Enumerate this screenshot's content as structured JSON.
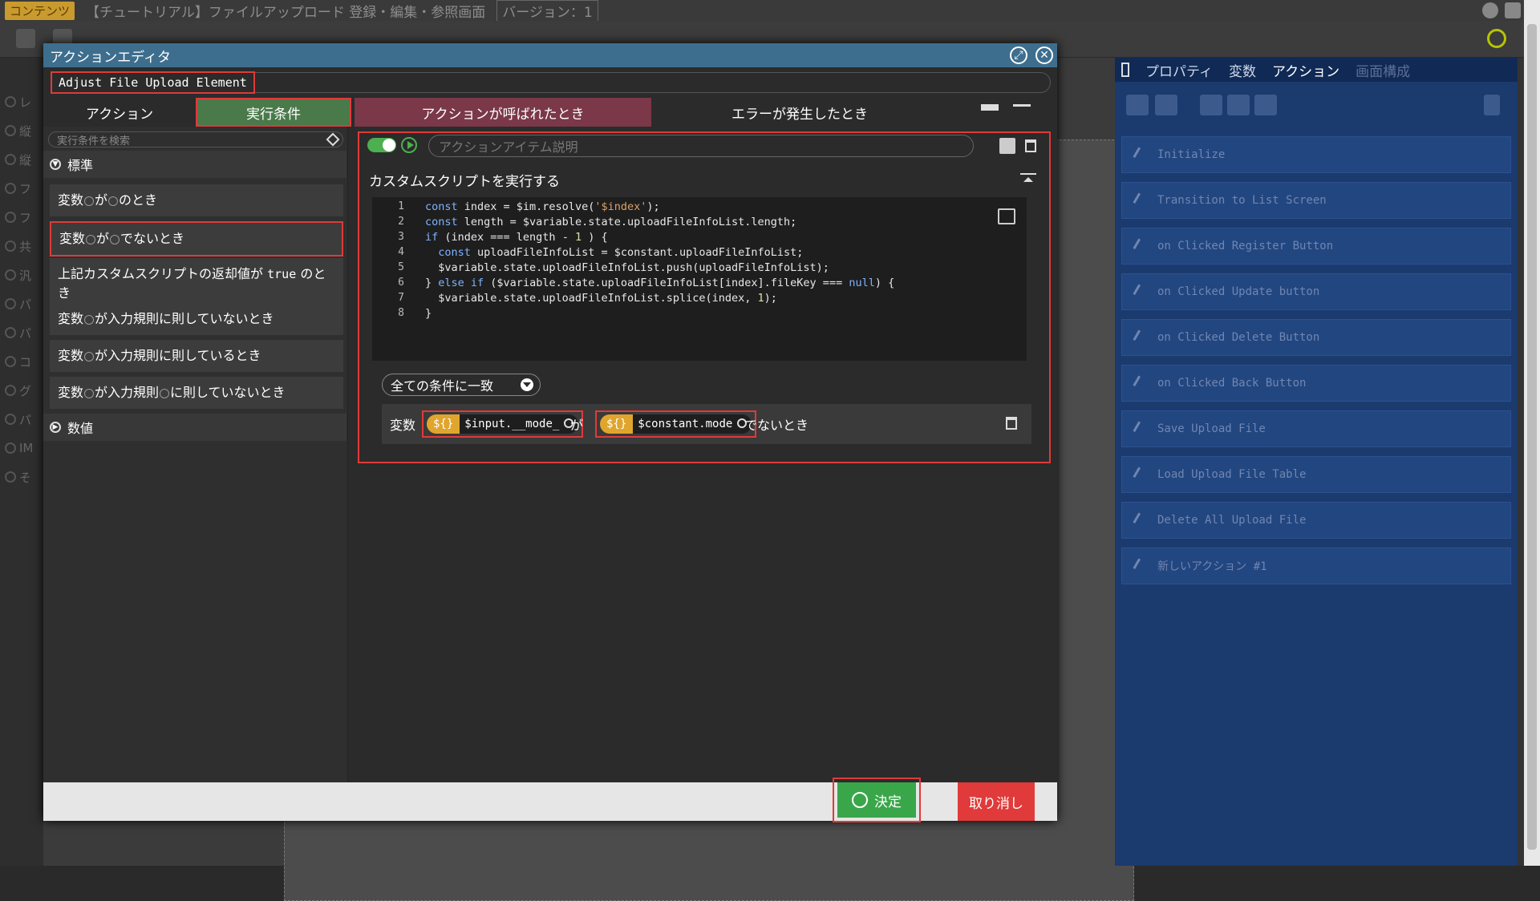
{
  "topbar": {
    "tag": "コンテンツ",
    "title": "【チュートリアル】ファイルアップロード 登録・編集・参照画面",
    "version": "バージョン：1"
  },
  "right_panel": {
    "tabs": [
      "プロパティ",
      "変数",
      "アクション",
      "画面構成"
    ],
    "actions": [
      "Initialize",
      "Transition to List Screen",
      "on Clicked Register Button",
      "on Clicked Update button",
      "on Clicked Delete Button",
      "on Clicked Back Button",
      "Save Upload File",
      "Load Upload File Table",
      "Delete All Upload File",
      "新しいアクション #1"
    ]
  },
  "left_strip": [
    "レ",
    "縦",
    "縦",
    "フ",
    "フ",
    "共",
    "汎",
    "パ",
    "パ",
    "コ",
    "グ",
    "パ",
    "IM",
    "そ"
  ],
  "modal": {
    "title": "アクションエディタ",
    "action_name": "Adjust File Upload Element",
    "tabs": {
      "action": "アクション",
      "condition": "実行条件",
      "called": "アクションが呼ばれたとき",
      "error": "エラーが発生したとき"
    },
    "search_placeholder": "実行条件を検索",
    "category_standard": "標準",
    "category_numeric": "数値",
    "conditions": {
      "c1a": "変数",
      "c1b": "が",
      "c1c": "のとき",
      "c2a": "変数",
      "c2b": "が",
      "c2c": "でないとき",
      "c3a": "上記カスタムスクリプトの返却値が",
      "c3b": "true",
      "c3c": "のとき",
      "c4a": "変数",
      "c4b": "が入力規則に則していないとき",
      "c5a": "変数",
      "c5b": "が入力規則に則しているとき",
      "c6a": "変数",
      "c6b": "が入力規則",
      "c6c": "に則していないとき"
    },
    "item_desc_placeholder": "アクションアイテム説明",
    "section_title": "カスタムスクリプトを実行する",
    "code_lines": [
      "1",
      "2",
      "3",
      "4",
      "5",
      "6",
      "7",
      "8"
    ],
    "match_label": "全ての条件に一致",
    "cond_row": {
      "var_label": "変数",
      "sym": "${}",
      "left": "$input.__mode_",
      "ga": "が",
      "right": "$constant.mode",
      "suffix": "でないとき"
    },
    "ok": "決定",
    "cancel": "取り消し"
  }
}
